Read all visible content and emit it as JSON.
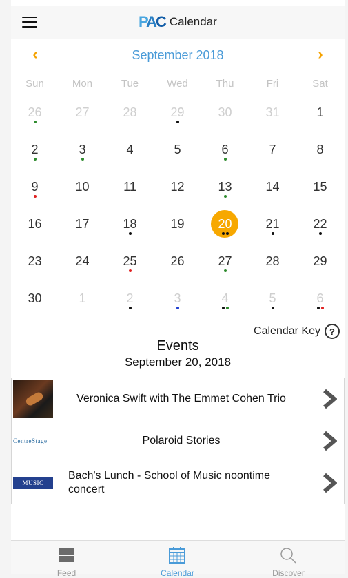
{
  "header": {
    "logo": "PAC",
    "title": "Calendar"
  },
  "calendar": {
    "month_label": "September 2018",
    "weekdays": [
      "Sun",
      "Mon",
      "Tue",
      "Wed",
      "Thu",
      "Fri",
      "Sat"
    ],
    "colors": {
      "black": "#111111",
      "green": "#2e8b2e",
      "red": "#e02020",
      "blue": "#1f3ed0",
      "selected": "#f7a800",
      "accent": "#f5a200",
      "month": "#4a9bd8"
    },
    "weeks": [
      [
        {
          "d": "26",
          "other": true,
          "dots": [
            "green"
          ]
        },
        {
          "d": "27",
          "other": true,
          "dots": []
        },
        {
          "d": "28",
          "other": true,
          "dots": []
        },
        {
          "d": "29",
          "other": true,
          "dots": [
            "black"
          ]
        },
        {
          "d": "30",
          "other": true,
          "dots": []
        },
        {
          "d": "31",
          "other": true,
          "dots": []
        },
        {
          "d": "1",
          "dots": []
        }
      ],
      [
        {
          "d": "2",
          "dots": [
            "green"
          ]
        },
        {
          "d": "3",
          "dots": [
            "green"
          ]
        },
        {
          "d": "4",
          "dots": []
        },
        {
          "d": "5",
          "dots": []
        },
        {
          "d": "6",
          "dots": [
            "green"
          ]
        },
        {
          "d": "7",
          "dots": []
        },
        {
          "d": "8",
          "dots": []
        }
      ],
      [
        {
          "d": "9",
          "dots": [
            "red"
          ]
        },
        {
          "d": "10",
          "dots": []
        },
        {
          "d": "11",
          "dots": []
        },
        {
          "d": "12",
          "dots": []
        },
        {
          "d": "13",
          "dots": [
            "green"
          ]
        },
        {
          "d": "14",
          "dots": []
        },
        {
          "d": "15",
          "dots": []
        }
      ],
      [
        {
          "d": "16",
          "dots": []
        },
        {
          "d": "17",
          "dots": []
        },
        {
          "d": "18",
          "dots": [
            "black"
          ]
        },
        {
          "d": "19",
          "dots": []
        },
        {
          "d": "20",
          "selected": true,
          "dots": [
            "black",
            "black"
          ]
        },
        {
          "d": "21",
          "dots": [
            "black"
          ]
        },
        {
          "d": "22",
          "dots": [
            "black"
          ]
        }
      ],
      [
        {
          "d": "23",
          "dots": []
        },
        {
          "d": "24",
          "dots": []
        },
        {
          "d": "25",
          "dots": [
            "red"
          ]
        },
        {
          "d": "26",
          "dots": []
        },
        {
          "d": "27",
          "dots": [
            "green"
          ]
        },
        {
          "d": "28",
          "dots": []
        },
        {
          "d": "29",
          "dots": []
        }
      ],
      [
        {
          "d": "30",
          "dots": []
        },
        {
          "d": "1",
          "other": true,
          "dots": []
        },
        {
          "d": "2",
          "other": true,
          "dots": [
            "black"
          ]
        },
        {
          "d": "3",
          "other": true,
          "dots": [
            "blue"
          ]
        },
        {
          "d": "4",
          "other": true,
          "dots": [
            "black",
            "green"
          ]
        },
        {
          "d": "5",
          "other": true,
          "dots": [
            "black"
          ]
        },
        {
          "d": "6",
          "other": true,
          "dots": [
            "black",
            "red"
          ]
        }
      ]
    ]
  },
  "calendar_key": {
    "label": "Calendar Key",
    "icon": "help-icon"
  },
  "events_section": {
    "title": "Events",
    "date": "September 20, 2018",
    "items": [
      {
        "title": "Veronica Swift with The Emmet Cohen Trio",
        "thumb": "violin"
      },
      {
        "title": "Polaroid Stories",
        "thumb": "centrestage",
        "thumb_text": "CentreStage"
      },
      {
        "title": "Bach's Lunch - School of Music noontime concert",
        "thumb": "music",
        "thumb_text": "MUSIC"
      }
    ]
  },
  "tabs": [
    {
      "label": "Feed",
      "icon": "feed-icon"
    },
    {
      "label": "Calendar",
      "icon": "calendar-icon",
      "active": true
    },
    {
      "label": "Discover",
      "icon": "search-icon"
    }
  ]
}
